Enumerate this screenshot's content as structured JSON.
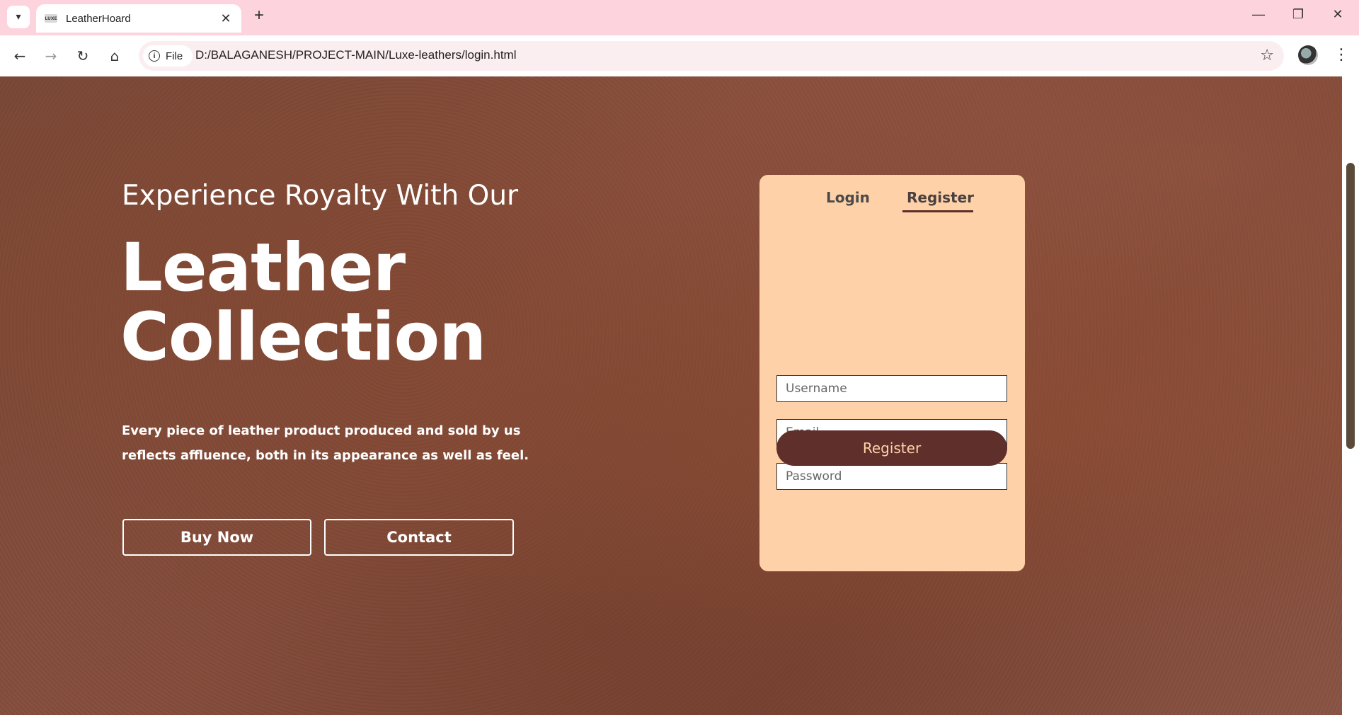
{
  "browser": {
    "tab_title": "LeatherHoard",
    "favicon_text": "LUXE",
    "address_chip": "File",
    "url": "D:/BALAGANESH/PROJECT-MAIN/Luxe-leathers/login.html"
  },
  "hero": {
    "subtitle": "Experience Royalty With Our",
    "title_line1": "Leather",
    "title_line2": "Collection",
    "description": "Every piece of leather product produced and sold by us reflects affluence, both in its appearance as well as feel.",
    "buy_button": "Buy Now",
    "contact_button": "Contact"
  },
  "auth_card": {
    "tabs": [
      "Login",
      "Register"
    ],
    "active_tab": "Register",
    "fields": {
      "username_placeholder": "Username",
      "email_placeholder": "Email",
      "password_placeholder": "Password"
    },
    "submit_label": "Register"
  },
  "colors": {
    "card_bg": "#ffd1a8",
    "button_bg": "#5e2f2b",
    "browser_frame": "#fdd3dd"
  }
}
